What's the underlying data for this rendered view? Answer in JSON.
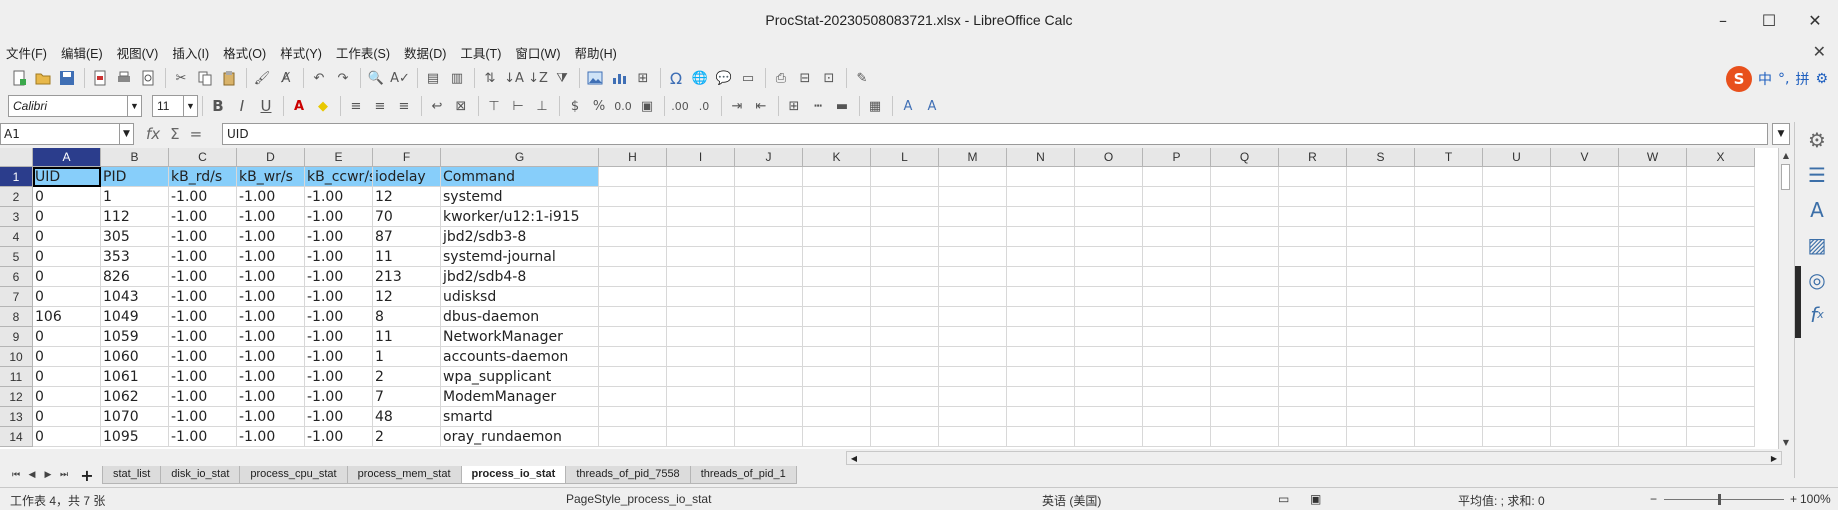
{
  "window": {
    "title": "ProcStat-20230508083721.xlsx - LibreOffice Calc",
    "minimize_glyph": "–",
    "maximize_glyph": "☐",
    "close_glyph": "✕"
  },
  "menubar": {
    "items": [
      "文件(F)",
      "编辑(E)",
      "视图(V)",
      "插入(I)",
      "格式(O)",
      "样式(Y)",
      "工作表(S)",
      "数据(D)",
      "工具(T)",
      "窗口(W)",
      "帮助(H)"
    ],
    "close_doc_glyph": "✕"
  },
  "formatting": {
    "font_name": "Calibri",
    "font_size": "11",
    "bold": "B",
    "italic": "I",
    "underline": "U"
  },
  "ime": {
    "logo": "S",
    "label_chinese": "中",
    "label_punct": "°,",
    "label_pinyin": "拼"
  },
  "formula_bar": {
    "name_box": "A1",
    "content": "UID",
    "fx_glyph": "fx",
    "sum_glyph": "Σ",
    "equals_glyph": "="
  },
  "grid": {
    "columns": [
      "A",
      "B",
      "C",
      "D",
      "E",
      "F",
      "G",
      "H",
      "I",
      "J",
      "K",
      "L",
      "M",
      "N",
      "O",
      "P",
      "Q",
      "R",
      "S",
      "T",
      "U",
      "V",
      "W",
      "X"
    ],
    "row_numbers": [
      "1",
      "2",
      "3",
      "4",
      "5",
      "6",
      "7",
      "8",
      "9",
      "10",
      "11",
      "12",
      "13",
      "14"
    ],
    "rows": [
      [
        "UID",
        "PID",
        "kB_rd/s",
        "kB_wr/s",
        "kB_ccwr/s",
        "iodelay",
        "Command"
      ],
      [
        "0",
        "1",
        "-1.00",
        "-1.00",
        "-1.00",
        "12",
        "systemd"
      ],
      [
        "0",
        "112",
        "-1.00",
        "-1.00",
        "-1.00",
        "70",
        "kworker/u12:1-i915"
      ],
      [
        "0",
        "305",
        "-1.00",
        "-1.00",
        "-1.00",
        "87",
        "jbd2/sdb3-8"
      ],
      [
        "0",
        "353",
        "-1.00",
        "-1.00",
        "-1.00",
        "11",
        "systemd-journal"
      ],
      [
        "0",
        "826",
        "-1.00",
        "-1.00",
        "-1.00",
        "213",
        "jbd2/sdb4-8"
      ],
      [
        "0",
        "1043",
        "-1.00",
        "-1.00",
        "-1.00",
        "12",
        "udisksd"
      ],
      [
        "106",
        "1049",
        "-1.00",
        "-1.00",
        "-1.00",
        "8",
        "dbus-daemon"
      ],
      [
        "0",
        "1059",
        "-1.00",
        "-1.00",
        "-1.00",
        "11",
        "NetworkManager"
      ],
      [
        "0",
        "1060",
        "-1.00",
        "-1.00",
        "-1.00",
        "1",
        "accounts-daemon"
      ],
      [
        "0",
        "1061",
        "-1.00",
        "-1.00",
        "-1.00",
        "2",
        "wpa_supplicant"
      ],
      [
        "0",
        "1062",
        "-1.00",
        "-1.00",
        "-1.00",
        "7",
        "ModemManager"
      ],
      [
        "0",
        "1070",
        "-1.00",
        "-1.00",
        "-1.00",
        "48",
        "smartd"
      ],
      [
        "0",
        "1095",
        "-1.00",
        "-1.00",
        "-1.00",
        "2",
        "oray_rundaemon"
      ]
    ]
  },
  "sheet_tabs": {
    "add_glyph": "+",
    "tabs": [
      "stat_list",
      "disk_io_stat",
      "process_cpu_stat",
      "process_mem_stat",
      "process_io_stat",
      "threads_of_pid_7558",
      "threads_of_pid_1"
    ],
    "active": "process_io_stat"
  },
  "status": {
    "sheet_position": "工作表 4，共 7 张",
    "page_style": "PageStyle_process_io_stat",
    "language": "英语 (美国)",
    "summary": "平均值: ; 求和: 0",
    "zoom_minus": "−",
    "zoom_plus": "+",
    "zoom": "100%"
  },
  "colors": {
    "header_fill": "#87CEFA",
    "selection_header": "#2B3D8C"
  }
}
